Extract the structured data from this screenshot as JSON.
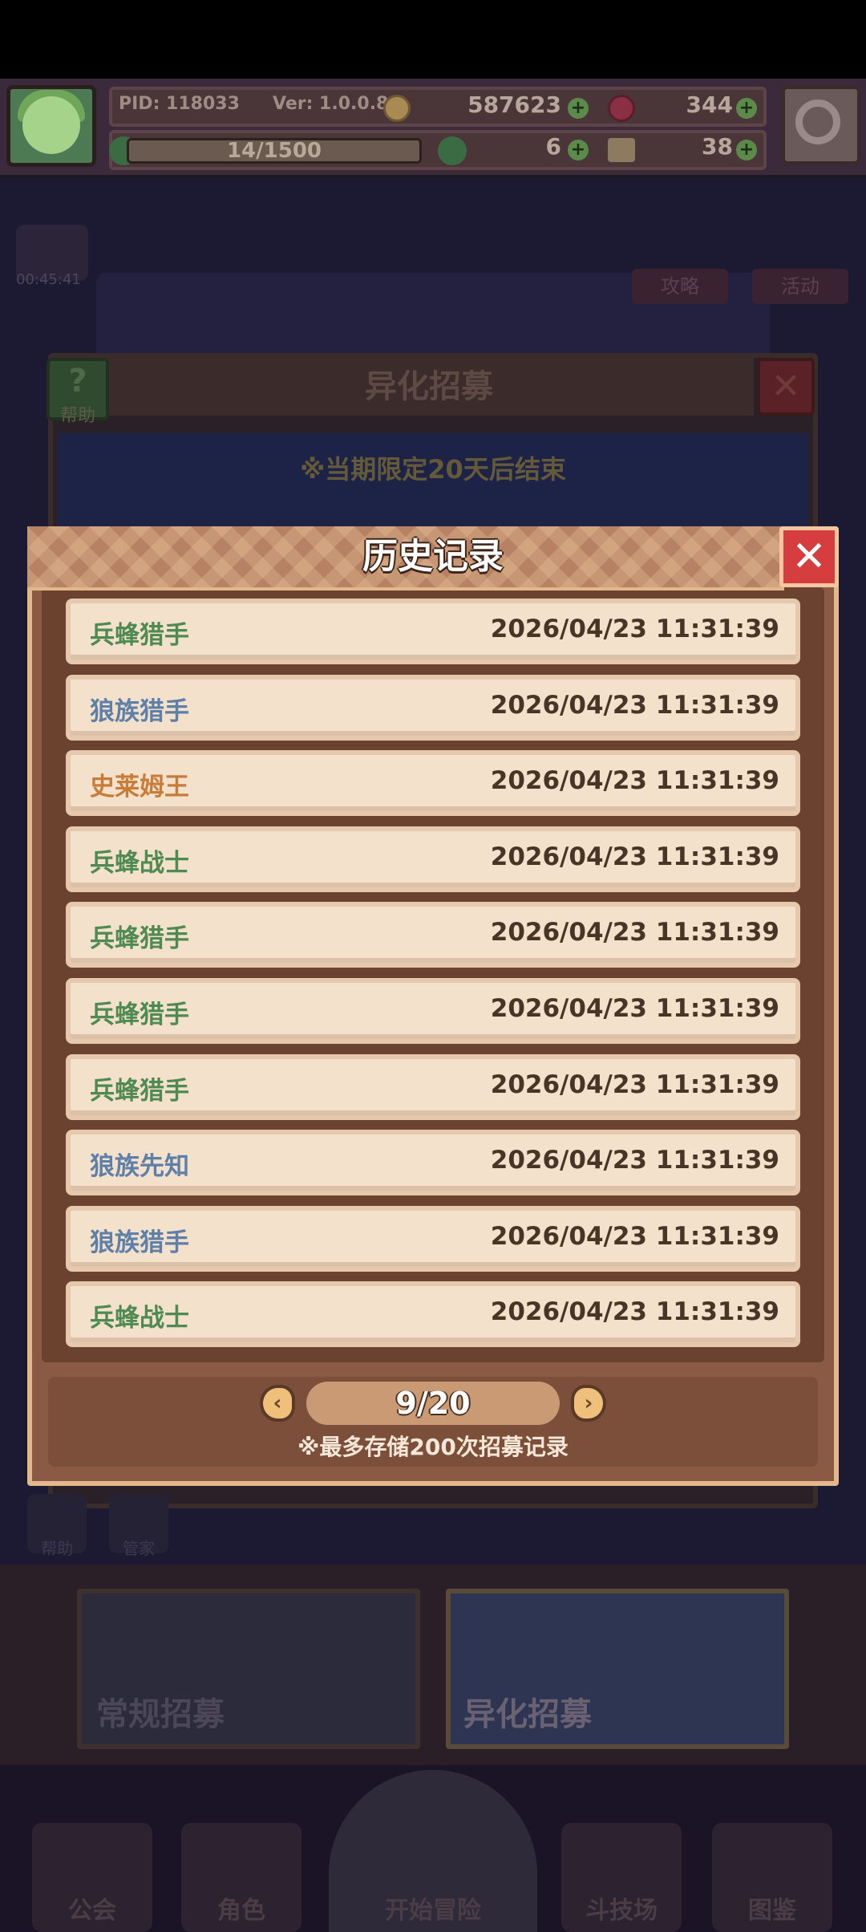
{
  "header": {
    "pid": "PID: 118033",
    "version": "Ver: 1.0.0.8",
    "gold": "587623",
    "gems": "344",
    "exp": "14/1500",
    "clover": "6",
    "keys": "38",
    "plus": "+"
  },
  "background": {
    "timer": "00:45:41",
    "guide_btn": "攻略",
    "activity_btn": "活动",
    "recruit_panel_title": "异化招募",
    "help_label": "帮助",
    "limited_text": "※当期限定20天后结束",
    "side_btn_1": "帮助",
    "side_btn_2": "管家",
    "card_normal": "常规招募",
    "card_special": "异化招募"
  },
  "nav": {
    "guild": "公会",
    "character": "角色",
    "adventure": "开始冒险",
    "arena": "斗技场",
    "codex": "图鉴"
  },
  "modal": {
    "title": "历史记录",
    "close": "✕",
    "records": [
      {
        "name": "兵蜂猎手",
        "time": "2026/04/23 11:31:39",
        "color": "#4e8a52"
      },
      {
        "name": "狼族猎手",
        "time": "2026/04/23 11:31:39",
        "color": "#5d7fa8"
      },
      {
        "name": "史莱姆王",
        "time": "2026/04/23 11:31:39",
        "color": "#c87c3a"
      },
      {
        "name": "兵蜂战士",
        "time": "2026/04/23 11:31:39",
        "color": "#4e8a52"
      },
      {
        "name": "兵蜂猎手",
        "time": "2026/04/23 11:31:39",
        "color": "#4e8a52"
      },
      {
        "name": "兵蜂猎手",
        "time": "2026/04/23 11:31:39",
        "color": "#4e8a52"
      },
      {
        "name": "兵蜂猎手",
        "time": "2026/04/23 11:31:39",
        "color": "#4e8a52"
      },
      {
        "name": "狼族先知",
        "time": "2026/04/23 11:31:39",
        "color": "#5d7fa8"
      },
      {
        "name": "狼族猎手",
        "time": "2026/04/23 11:31:39",
        "color": "#5d7fa8"
      },
      {
        "name": "兵蜂战士",
        "time": "2026/04/23 11:31:39",
        "color": "#4e8a52"
      }
    ],
    "page": "9/20",
    "prev_arrow": "‹",
    "next_arrow": "›",
    "note": "※最多存储200次招募记录"
  }
}
